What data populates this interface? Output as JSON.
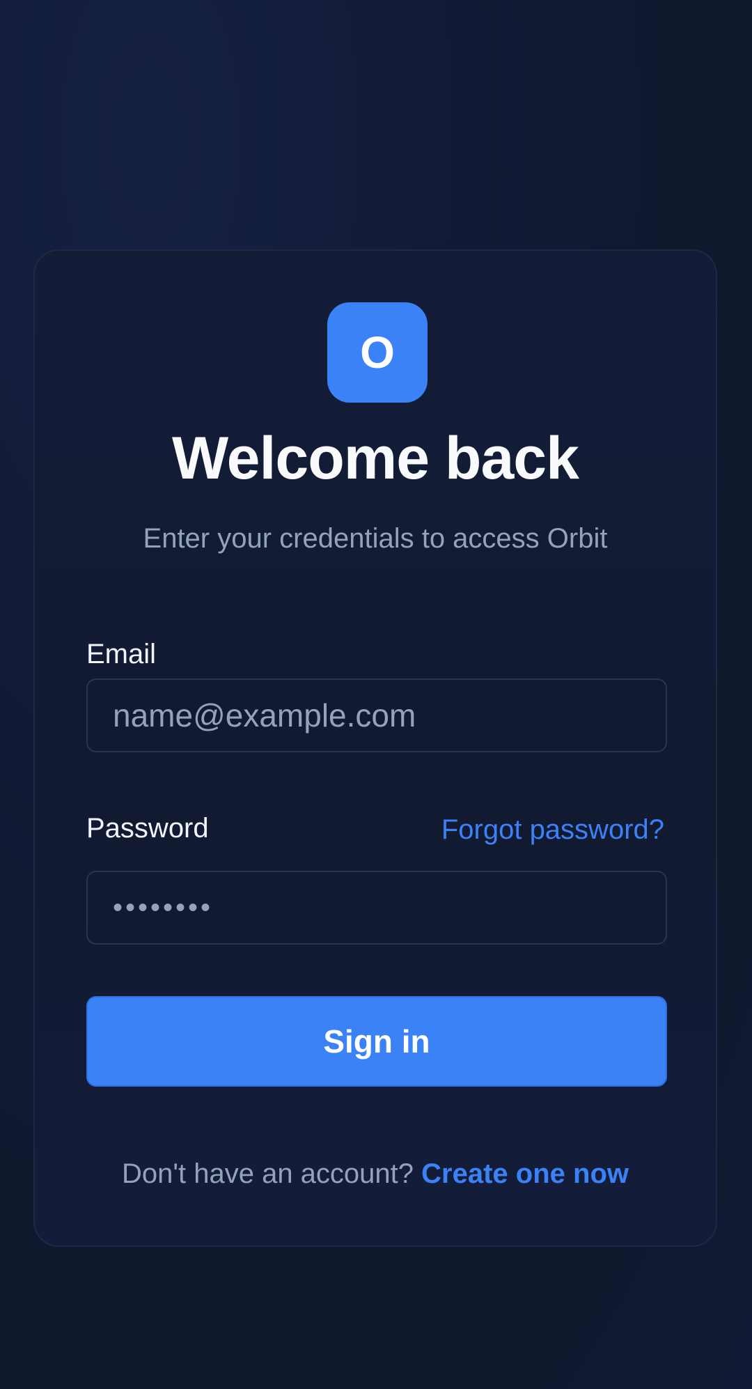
{
  "brand": {
    "logo_letter": "O",
    "accent_color": "#3b82f6"
  },
  "header": {
    "title": "Welcome back",
    "subtitle": "Enter your credentials to access Orbit"
  },
  "form": {
    "email": {
      "label": "Email",
      "placeholder": "name@example.com",
      "value": ""
    },
    "password": {
      "label": "Password",
      "masked_value": "••••••••",
      "forgot_link": "Forgot password?"
    },
    "submit_label": "Sign in"
  },
  "footer": {
    "prompt": "Don't have an account?",
    "link": "Create one now"
  }
}
